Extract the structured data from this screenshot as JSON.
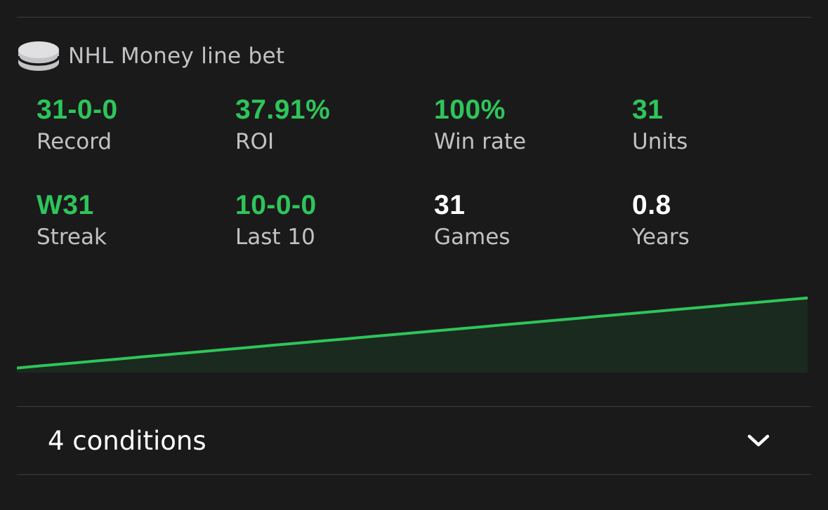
{
  "header": {
    "title": "NHL Money line bet",
    "icon": "hockey-puck-icon"
  },
  "stats": {
    "record": {
      "value": "31-0-0",
      "label": "Record",
      "color": "#2ec55a"
    },
    "roi": {
      "value": "37.91%",
      "label": "ROI",
      "color": "#2ec55a"
    },
    "win_rate": {
      "value": "100%",
      "label": "Win rate",
      "color": "#2ec55a"
    },
    "units": {
      "value": "31",
      "label": "Units",
      "color": "#2ec55a"
    },
    "streak": {
      "value": "W31",
      "label": "Streak",
      "color": "#2ec55a"
    },
    "last_10": {
      "value": "10-0-0",
      "label": "Last 10",
      "color": "#2ec55a"
    },
    "games": {
      "value": "31",
      "label": "Games",
      "color": "#ffffff"
    },
    "years": {
      "value": "0.8",
      "label": "Years",
      "color": "#ffffff"
    }
  },
  "conditions": {
    "label": "4 conditions",
    "icon": "chevron-down-icon"
  },
  "colors": {
    "accent_green": "#2ec55a",
    "area_fill": "#1a2a1e",
    "background": "#1b1a1b",
    "divider": "#3d3c3e",
    "secondary_text": "#c2c2c4"
  },
  "chart_data": {
    "type": "area",
    "title": "",
    "xlabel": "",
    "ylabel": "",
    "x": [
      0,
      1,
      2,
      3,
      4,
      5,
      6,
      7,
      8,
      9,
      10,
      11,
      12,
      13,
      14,
      15,
      16,
      17,
      18,
      19,
      20,
      21,
      22,
      23,
      24,
      25,
      26,
      27,
      28,
      29,
      30,
      31
    ],
    "values": [
      0,
      1,
      2,
      3,
      4,
      5,
      6,
      7,
      8,
      9,
      10,
      11,
      12,
      13,
      14,
      15,
      16,
      17,
      18,
      19,
      20,
      21,
      22,
      23,
      24,
      25,
      26,
      27,
      28,
      29,
      30,
      31
    ],
    "ylim": [
      -2,
      34
    ],
    "grid": false,
    "legend": "none"
  }
}
